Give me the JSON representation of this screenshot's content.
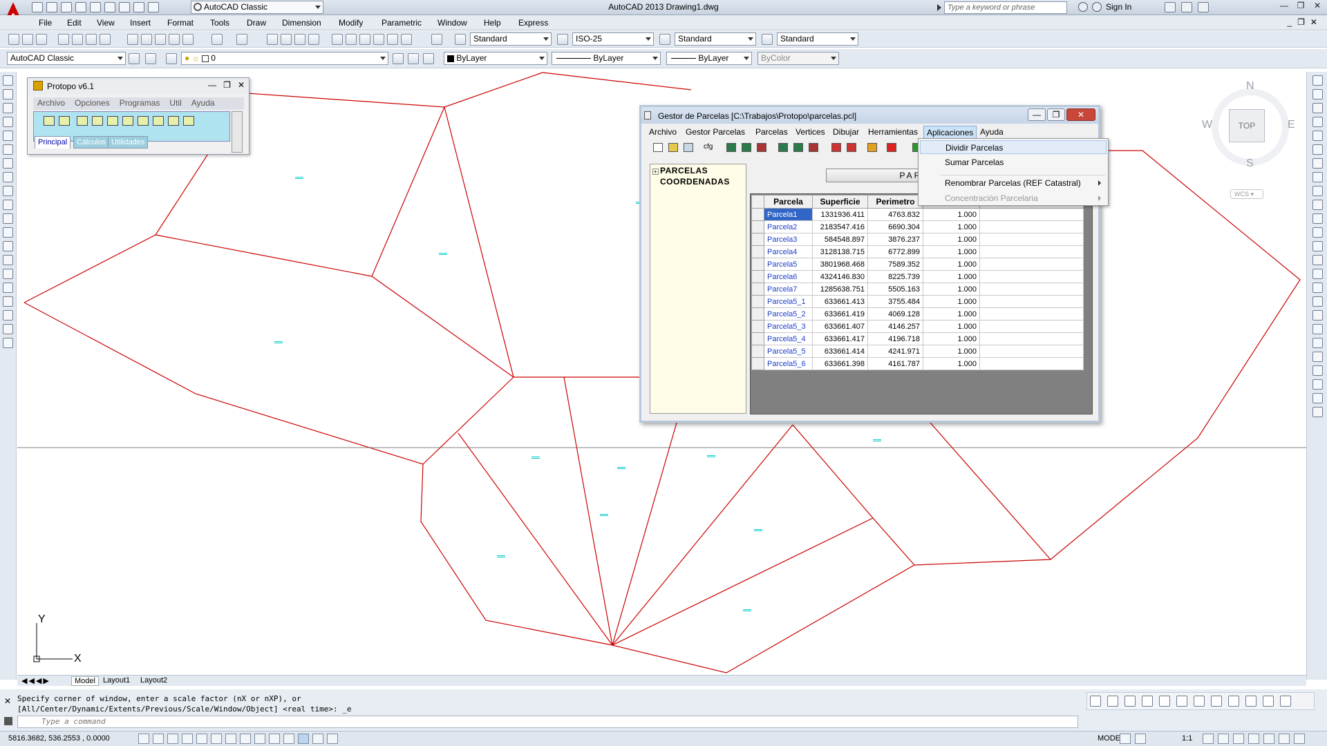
{
  "window": {
    "title": "AutoCAD 2013    Drawing1.dwg",
    "workspace": "AutoCAD Classic",
    "search_placeholder": "Type a keyword or phrase",
    "sign_in": "Sign In"
  },
  "menubar": [
    "File",
    "Edit",
    "View",
    "Insert",
    "Format",
    "Tools",
    "Draw",
    "Dimension",
    "Modify",
    "Parametric",
    "Window",
    "Help",
    "Express"
  ],
  "toolbar1": {
    "text_style": "Standard",
    "dim_style": "ISO-25",
    "table_style": "Standard",
    "multileader_style": "Standard"
  },
  "toolbar2": {
    "workspace": "AutoCAD Classic",
    "layer": "0",
    "color": "ByLayer",
    "linetype": "ByLayer",
    "lineweight": "ByLayer",
    "plotstyle": "ByColor"
  },
  "viewcube": {
    "north": "N",
    "south": "S",
    "east": "E",
    "west": "W",
    "face": "TOP",
    "wcs": "WCS"
  },
  "ucs": {
    "x": "X",
    "y": "Y"
  },
  "layout_tabs": [
    "Model",
    "Layout1",
    "Layout2"
  ],
  "command_history": "Specify corner of window, enter a scale factor (nX or nXP), or\n[All/Center/Dynamic/Extents/Previous/Scale/Window/Object] <real time>: _e",
  "command_placeholder": "Type a command",
  "status": {
    "coords": "5816.3682, 536.2553  , 0.0000",
    "model": "MODEL",
    "scale": "1:1"
  },
  "protopo": {
    "title": "Protopo v6.1",
    "menus": [
      "Archivo",
      "Opciones",
      "Programas",
      "Util",
      "Ayuda"
    ],
    "tabs": [
      "Principal",
      "Cálculos",
      "Utilidades"
    ]
  },
  "gestor": {
    "title": "Gestor de Parcelas  [C:\\Trabajos\\Protopo\\parcelas.pcl]",
    "menus": [
      "Archivo",
      "Gestor Parcelas",
      "Parcelas",
      "Vertices",
      "Dibujar",
      "Herramientas",
      "Aplicaciones",
      "Ayuda"
    ],
    "tree": [
      "PARCELAS",
      "COORDENADAS"
    ],
    "header_button": "PARC",
    "columns": [
      "Parcela",
      "Superficie",
      "Perimetro"
    ],
    "rows": [
      {
        "name": "Parcela1",
        "area": "1331936.411",
        "perim": "4763.832",
        "factor": "1.000"
      },
      {
        "name": "Parcela2",
        "area": "2183547.416",
        "perim": "6690.304",
        "factor": "1.000"
      },
      {
        "name": "Parcela3",
        "area": "584548.897",
        "perim": "3876.237",
        "factor": "1.000"
      },
      {
        "name": "Parcela4",
        "area": "3128138.715",
        "perim": "6772.899",
        "factor": "1.000"
      },
      {
        "name": "Parcela5",
        "area": "3801968.468",
        "perim": "7589.352",
        "factor": "1.000"
      },
      {
        "name": "Parcela6",
        "area": "4324146.830",
        "perim": "8225.739",
        "factor": "1.000"
      },
      {
        "name": "Parcela7",
        "area": "1285638.751",
        "perim": "5505.163",
        "factor": "1.000"
      },
      {
        "name": "Parcela5_1",
        "area": "633661.413",
        "perim": "3755.484",
        "factor": "1.000"
      },
      {
        "name": "Parcela5_2",
        "area": "633661.419",
        "perim": "4069.128",
        "factor": "1.000"
      },
      {
        "name": "Parcela5_3",
        "area": "633661.407",
        "perim": "4146.257",
        "factor": "1.000"
      },
      {
        "name": "Parcela5_4",
        "area": "633661.417",
        "perim": "4196.718",
        "factor": "1.000"
      },
      {
        "name": "Parcela5_5",
        "area": "633661.414",
        "perim": "4241.971",
        "factor": "1.000"
      },
      {
        "name": "Parcela5_6",
        "area": "633661.398",
        "perim": "4161.787",
        "factor": "1.000"
      }
    ]
  },
  "dropdown": {
    "items": [
      "Dividir Parcelas",
      "Sumar Parcelas",
      "Renombrar Parcelas (REF Catastral)",
      "Concentración Parcelaria"
    ]
  },
  "colors": {
    "parcel_lines": "#cc0000",
    "labels": "#00cccc",
    "selection": "#3166c6"
  }
}
